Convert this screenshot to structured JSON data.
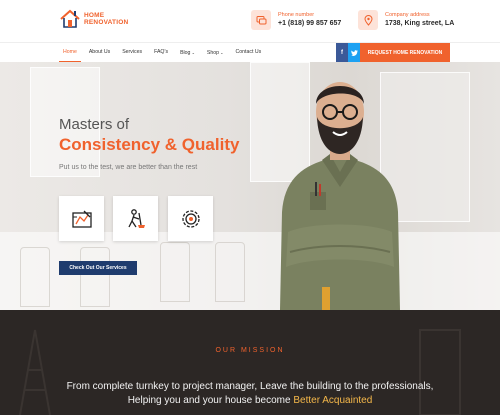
{
  "header": {
    "logo_line1": "HOME",
    "logo_line2": "RENOVATION",
    "phone_label": "Phone number",
    "phone_value": "+1 (818) 99 857 657",
    "address_label": "Company address",
    "address_value": "1738, King street, LA"
  },
  "nav": {
    "items": [
      "Home",
      "About Us",
      "Services",
      "FAQ's",
      "Blog",
      "Shop",
      "Contact Us"
    ],
    "has_dropdown": [
      false,
      false,
      false,
      false,
      true,
      true,
      false
    ],
    "active": "Home",
    "social": {
      "facebook": "f",
      "twitter": "t"
    },
    "cta": "REQUEST HOME RENOVATION"
  },
  "hero": {
    "title_line1": "Masters of",
    "title_line2": "Consistency & Quality",
    "subtitle": "Put us to the test, we are better than the rest",
    "features": [
      "blueprint-icon",
      "cleaning-icon",
      "settings-gear-icon"
    ],
    "button": "Check Out Our Services"
  },
  "mission": {
    "label": "OUR MISSION",
    "line1": "From complete turnkey to project manager, Leave the building to the professionals,",
    "line2_prefix": "Helping you and your house become ",
    "line2_highlight": "Better Acquainted"
  },
  "colors": {
    "accent": "#f0622d",
    "button_blue": "#1f3c6e",
    "mission_bg": "#2c2725",
    "highlight": "#f5b84a",
    "facebook": "#3b5998",
    "twitter": "#1da1f2"
  }
}
